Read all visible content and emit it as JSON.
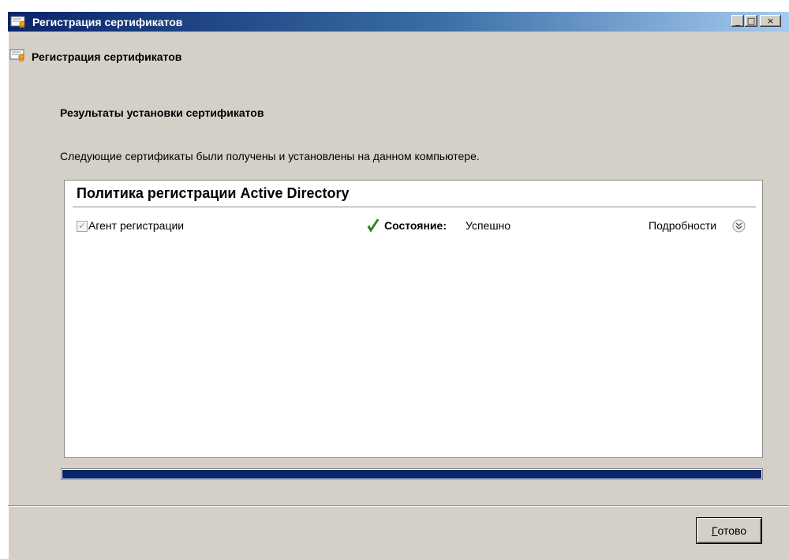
{
  "window": {
    "title": "Регистрация сертификатов",
    "controls": {
      "minimize": "_",
      "maximize": "□",
      "close": "×"
    }
  },
  "header": {
    "title": "Регистрация сертификатов",
    "icon": "certificate-icon"
  },
  "main": {
    "heading": "Результаты установки сертификатов",
    "description": "Следующие сертификаты были получены и установлены на данном компьютере.",
    "policy": {
      "title": "Политика регистрации Active Directory",
      "certificates": [
        {
          "checkbox_glyph": "✓",
          "name": "Агент регистрации",
          "checked": true,
          "status_icon": "green-checkmark-icon",
          "status_label": "Состояние:",
          "status_value": "Успешно",
          "details_label": "Подробности",
          "details_icon": "expand-chevrons-icon"
        }
      ]
    },
    "progress": {
      "value": 1.0
    }
  },
  "footer": {
    "done_button": {
      "mnemonic": "Г",
      "rest": "отово"
    }
  },
  "colors": {
    "titlebar_start": "#0a246a",
    "titlebar_end": "#a6caf0",
    "window_bg": "#d4d0c8",
    "progress_fill": "#0a246a",
    "success_green": "#2e8b1f"
  }
}
